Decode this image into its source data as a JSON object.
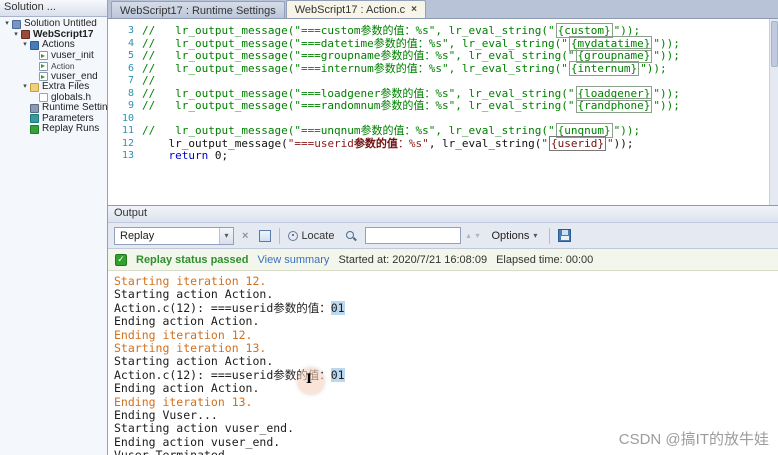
{
  "window": {
    "watermark": "CSDN @搞IT的放牛娃"
  },
  "sidebar": {
    "header": "Solution ...",
    "tree": [
      {
        "id": "solution-untitled",
        "label": "Solution Untitled",
        "level": 0,
        "icon": "solution",
        "expander": true
      },
      {
        "id": "webscript17",
        "label": "WebScript17",
        "level": 1,
        "icon": "script",
        "bold": true,
        "expander": true
      },
      {
        "id": "actions",
        "label": "Actions",
        "level": 2,
        "icon": "actions-folder",
        "expander": true
      },
      {
        "id": "vuser-init",
        "label": "vuser_init",
        "level": 3,
        "icon": "action-file"
      },
      {
        "id": "action",
        "label": "Action",
        "level": 3,
        "icon": "action-file",
        "small": true
      },
      {
        "id": "vuser-end",
        "label": "vuser_end",
        "level": 3,
        "icon": "action-file"
      },
      {
        "id": "extra-files",
        "label": "Extra Files",
        "level": 2,
        "icon": "folder",
        "expander": true
      },
      {
        "id": "globals-h",
        "label": "globals.h",
        "level": 3,
        "icon": "header-file"
      },
      {
        "id": "runtime-settings",
        "label": "Runtime Settings",
        "level": 2,
        "icon": "settings"
      },
      {
        "id": "parameters",
        "label": "Parameters",
        "level": 2,
        "icon": "parameters"
      },
      {
        "id": "replay-runs",
        "label": "Replay Runs",
        "level": 2,
        "icon": "replay"
      }
    ]
  },
  "tabs": [
    {
      "id": "runtime-settings",
      "label": "WebScript17 : Runtime Settings",
      "active": false
    },
    {
      "id": "action-c",
      "label": "WebScript17 : Action.c",
      "active": true,
      "close": "×"
    }
  ],
  "editor": {
    "lines": [
      {
        "num": 3,
        "segs": [
          {
            "s": "comment",
            "v": "//   lr_output_message(\"===custom参数的值：%s\", lr_eval_string(\""
          },
          {
            "s": "param-c",
            "v": "{custom}"
          },
          {
            "s": "comment",
            "v": "\"));"
          }
        ]
      },
      {
        "num": 4,
        "segs": [
          {
            "s": "comment",
            "v": "//   lr_output_message(\"===datetime参数的值：%s\", lr_eval_string(\""
          },
          {
            "s": "param-c",
            "v": "{mydatatime}"
          },
          {
            "s": "comment",
            "v": "\"));"
          }
        ]
      },
      {
        "num": 5,
        "segs": [
          {
            "s": "comment",
            "v": "//   lr_output_message(\"===groupname参数的值：%s\", lr_eval_string(\""
          },
          {
            "s": "param-c",
            "v": "{groupname}"
          },
          {
            "s": "comment",
            "v": "\"));"
          }
        ]
      },
      {
        "num": 6,
        "segs": [
          {
            "s": "comment",
            "v": "//   lr_output_message(\"===internum参数的值：%s\", lr_eval_string(\""
          },
          {
            "s": "param-c",
            "v": "{internum}"
          },
          {
            "s": "comment",
            "v": "\"));"
          }
        ]
      },
      {
        "num": 7,
        "segs": [
          {
            "s": "comment",
            "v": "//"
          }
        ]
      },
      {
        "num": 8,
        "segs": [
          {
            "s": "comment",
            "v": "//   lr_output_message(\"===loadgener参数的值：%s\", lr_eval_string(\""
          },
          {
            "s": "param-c",
            "v": "{loadgener}"
          },
          {
            "s": "comment",
            "v": "\"));"
          }
        ]
      },
      {
        "num": 9,
        "segs": [
          {
            "s": "comment",
            "v": "//   lr_output_message(\"===randomnum参数的值：%s\", lr_eval_string(\""
          },
          {
            "s": "param-c",
            "v": "{randphone}"
          },
          {
            "s": "comment",
            "v": "\"));"
          }
        ]
      },
      {
        "num": 10,
        "segs": []
      },
      {
        "num": 11,
        "segs": [
          {
            "s": "comment",
            "v": "//   lr_output_message(\"===unqnum参数的值：%s\", lr_eval_string(\""
          },
          {
            "s": "param-c",
            "v": "{unqnum}"
          },
          {
            "s": "comment",
            "v": "\"));"
          }
        ]
      },
      {
        "num": 12,
        "segs": [
          {
            "s": "plain",
            "v": "    lr_output_message("
          },
          {
            "s": "string",
            "v": "\"===userid"
          },
          {
            "s": "string-b",
            "v": "参数的值"
          },
          {
            "s": "string",
            "v": "：%s\""
          },
          {
            "s": "plain",
            "v": ", lr_eval_string("
          },
          {
            "s": "string",
            "v": "\""
          },
          {
            "s": "param",
            "v": "{userid}"
          },
          {
            "s": "string",
            "v": "\""
          },
          {
            "s": "plain",
            "v": "));"
          }
        ]
      },
      {
        "num": 13,
        "segs": [
          {
            "s": "plain",
            "v": "    "
          },
          {
            "s": "keyword",
            "v": "return"
          },
          {
            "s": "plain",
            "v": " 0;"
          }
        ]
      }
    ]
  },
  "output": {
    "title": "Output",
    "toolbar": {
      "mode": "Replay",
      "locate_label": "Locate",
      "options_label": "Options",
      "search_value": ""
    },
    "status": {
      "text": "Replay status passed",
      "link": "View summary",
      "started": "Started at: 2020/7/21 16:08:09",
      "elapsed": "Elapsed time: 00:00"
    },
    "log": [
      {
        "type": "iteration",
        "text": "Starting iteration 12."
      },
      {
        "type": "normal",
        "text": "Starting action Action."
      },
      {
        "type": "message",
        "text": "Action.c(12): ===userid参数的值：",
        "value": "01"
      },
      {
        "type": "normal",
        "text": "Ending action Action."
      },
      {
        "type": "iteration",
        "text": "Ending iteration 12."
      },
      {
        "type": "iteration",
        "text": "Starting iteration 13."
      },
      {
        "type": "normal",
        "text": "Starting action Action."
      },
      {
        "type": "message",
        "text": "Action.c(12): ===userid参数的值：",
        "value": "01"
      },
      {
        "type": "normal",
        "text": "Ending action Action."
      },
      {
        "type": "iteration",
        "text": "Ending iteration 13."
      },
      {
        "type": "normal",
        "text": "Ending Vuser..."
      },
      {
        "type": "normal",
        "text": "Starting action vuser_end."
      },
      {
        "type": "normal",
        "text": "Ending action vuser_end."
      },
      {
        "type": "normal",
        "text": "Vuser Terminated."
      }
    ]
  }
}
